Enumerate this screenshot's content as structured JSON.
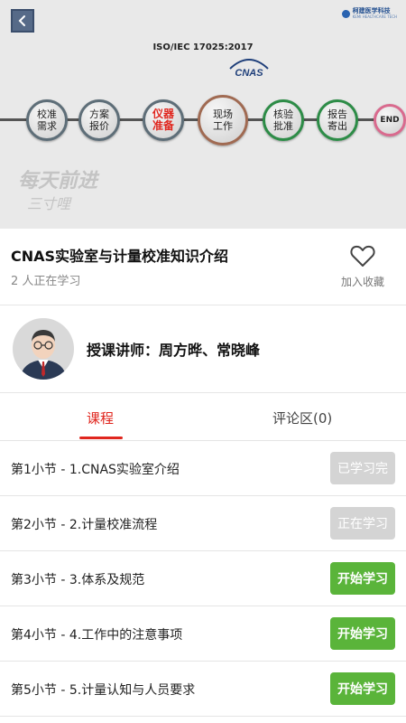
{
  "banner": {
    "brand_name": "柯建医学科技",
    "brand_sub": "KEMI HEALTHCARE TECH",
    "iso_text": "ISO/IEC 17025:2017",
    "cnas_text": "CNAS",
    "motto_line1": "每天前进",
    "motto_line2": "三寸哩",
    "steps": [
      {
        "line1": "校准",
        "line2": "需求"
      },
      {
        "line1": "方案",
        "line2": "报价"
      },
      {
        "line1": "仪器",
        "line2": "准备"
      },
      {
        "line1": "现场",
        "line2": "工作"
      },
      {
        "line1": "核验",
        "line2": "批准"
      },
      {
        "line1": "报告",
        "line2": "寄出"
      },
      {
        "line1": "END",
        "line2": ""
      }
    ]
  },
  "course": {
    "title": "CNAS实验室与计量校准知识介绍",
    "learners": "2 人正在学习",
    "favorite_label": "加入收藏"
  },
  "teacher": {
    "text": "授课讲师：周方晔、常晓峰"
  },
  "tabs": {
    "course": "课程",
    "comments": "评论区(0)"
  },
  "sections": [
    {
      "label": "第1小节 - 1.CNAS实验室介绍",
      "action": "已学习完",
      "state": "done"
    },
    {
      "label": "第2小节 - 2.计量校准流程",
      "action": "正在学习",
      "state": "current"
    },
    {
      "label": "第3小节 - 3.体系及规范",
      "action": "开始学习",
      "state": "start"
    },
    {
      "label": "第4小节 - 4.工作中的注意事项",
      "action": "开始学习",
      "state": "start"
    },
    {
      "label": "第5小节 - 5.计量认知与人员要求",
      "action": "开始学习",
      "state": "start"
    }
  ],
  "colors": {
    "accent_red": "#e0261e",
    "start_green": "#5ab43a",
    "disabled_gray": "#d4d4d4"
  }
}
